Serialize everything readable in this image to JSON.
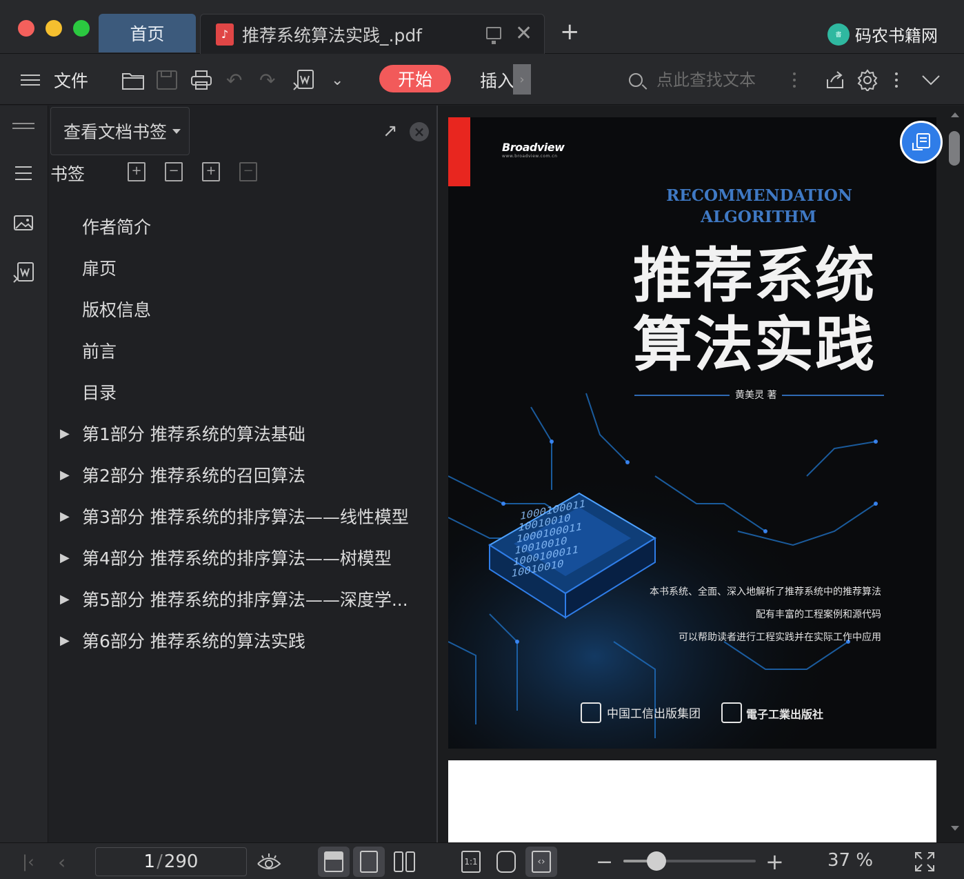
{
  "window": {
    "traffic_lights": {
      "close": "#f4605c",
      "minimize": "#f5bf2f",
      "maximize": "#2bc840"
    }
  },
  "tabs": [
    {
      "label": "首页",
      "active": false
    },
    {
      "label": "推荐系统算法实践_.pdf",
      "active": true,
      "icon": "pdf-icon"
    }
  ],
  "brand": {
    "logo_text": "码农书籍网",
    "name": "码农书籍网"
  },
  "toolbar": {
    "file_label": "文件",
    "start_label": "开始",
    "insert_label": "插入",
    "search_placeholder": "点此查找文本",
    "accent": "#f25a5a"
  },
  "panel": {
    "selector_label": "查看文档书签",
    "bookmarks_label": "书签",
    "items": [
      {
        "label": "作者简介",
        "expandable": false
      },
      {
        "label": "扉页",
        "expandable": false
      },
      {
        "label": "版权信息",
        "expandable": false
      },
      {
        "label": "前言",
        "expandable": false
      },
      {
        "label": "目录",
        "expandable": false
      },
      {
        "label": "第1部分  推荐系统的算法基础",
        "expandable": true
      },
      {
        "label": "第2部分  推荐系统的召回算法",
        "expandable": true
      },
      {
        "label": "第3部分  推荐系统的排序算法——线性模型",
        "expandable": true
      },
      {
        "label": "第4部分  推荐系统的排序算法——树模型",
        "expandable": true
      },
      {
        "label": "第5部分  推荐系统的排序算法——深度学...",
        "expandable": true
      },
      {
        "label": "第6部分  推荐系统的算法实践",
        "expandable": true
      }
    ]
  },
  "cover": {
    "publisher_logo": "Broadview",
    "publisher_url": "www.broadview.com.cn",
    "title_en_1": "RECOMMENDATION",
    "title_en_2": "ALGORITHM",
    "title_zh_1": "推荐系统",
    "title_zh_2": "算法实践",
    "author": "黄美灵  著",
    "desc_1": "本书系统、全面、深入地解析了推荐系统中的推荐算法",
    "desc_2": "配有丰富的工程案例和源代码",
    "desc_3": "可以帮助读者进行工程实践并在实际工作中应用",
    "publisher_1": "中国工信出版集团",
    "publisher_2": "電子工業出版社",
    "bits": "1000100011\n10010010\n1000100011\n10010010\n1000100011\n10010010"
  },
  "status": {
    "current_page": "1",
    "page_separator": "/",
    "total_pages": "290",
    "zoom": "37 %",
    "zoom_fraction": 0.25
  }
}
